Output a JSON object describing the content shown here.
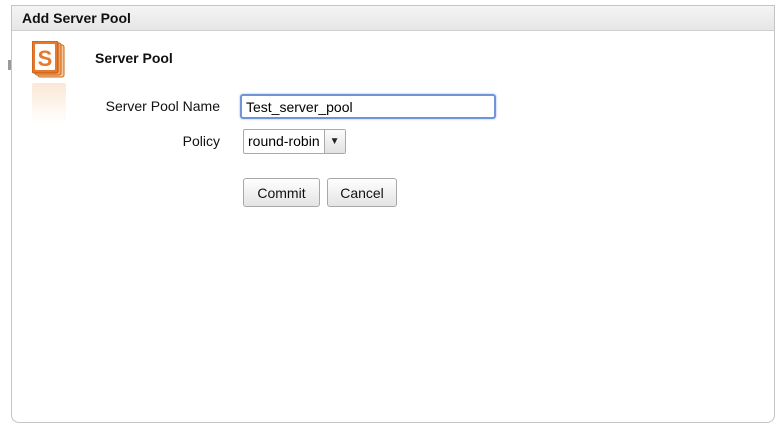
{
  "dialog": {
    "title": "Add Server Pool"
  },
  "section": {
    "title": "Server Pool",
    "icon": "server-pool-icon"
  },
  "form": {
    "name_label": "Server Pool Name",
    "name_value": "Test_server_pool",
    "policy_label": "Policy",
    "policy_value": "round-robin"
  },
  "buttons": {
    "commit_label": "Commit",
    "cancel_label": "Cancel"
  },
  "colors": {
    "icon_orange": "#e8782a",
    "focus_border": "#6f95d8"
  }
}
